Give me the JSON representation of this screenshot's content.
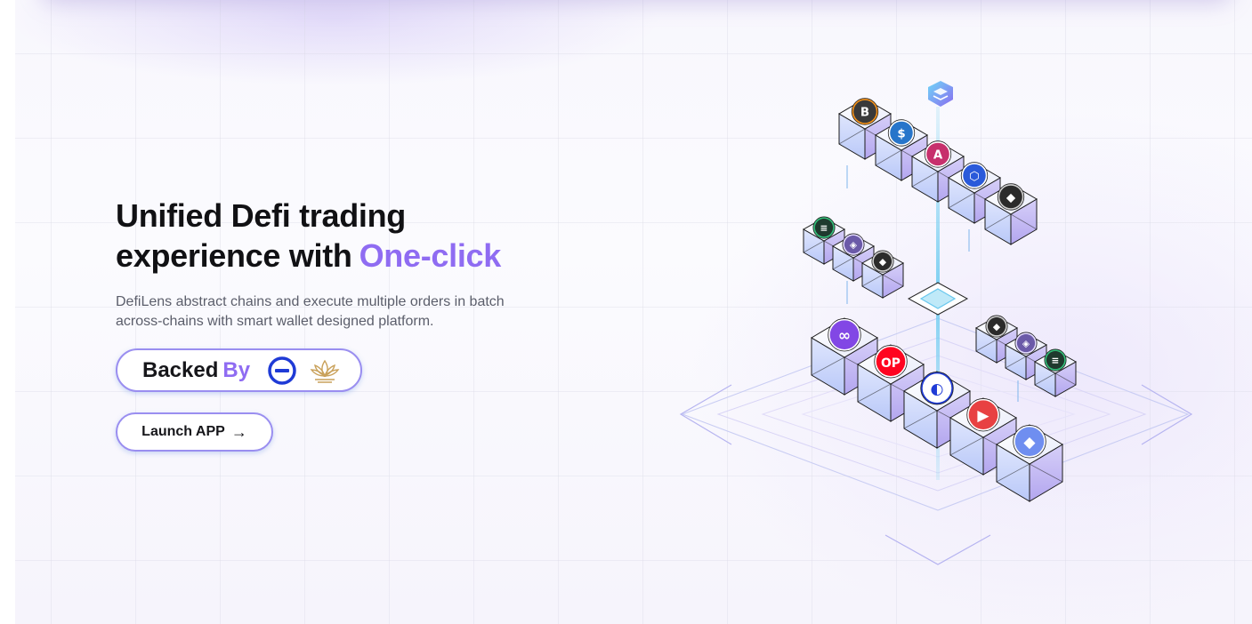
{
  "hero": {
    "title_line1": "Unified Defi trading",
    "title_line2": "experience with",
    "title_accent": "One-click",
    "description_line1": "DefiLens abstract chains and execute multiple orders in batch",
    "description_line2": "across-chains with smart wallet designed platform."
  },
  "backed": {
    "label": "Backed",
    "by": "By",
    "backers": [
      {
        "icon": "blue-circle-minus-logo-icon"
      },
      {
        "icon": "gold-lotus-logo-icon"
      }
    ]
  },
  "cta": {
    "label": "Launch APP",
    "arrow": "→"
  },
  "illustration": {
    "top_icon": "stack-layers-icon",
    "row_a_tokens": [
      "bitcoin-token-icon",
      "usdc-token-icon",
      "aave-token-icon",
      "chainlink-token-icon",
      "dark-token-icon"
    ],
    "row_b_tokens": [
      "green-token-icon",
      "purple-token-icon",
      "dark-token-icon"
    ],
    "row_c_tokens": [
      "polygon-token-icon",
      "optimism-token-icon",
      "blue-bridge-token-icon",
      "red-play-token-icon",
      "ethereum-token-icon"
    ],
    "row_d_tokens": [
      "dark-token-icon",
      "purple-token-icon",
      "green-token-icon"
    ],
    "op_label": "OP",
    "colors": {
      "accent": "#8f6cf2",
      "cube_face_light": "#eef0ff",
      "cube_face_blue": "#c8d4fb",
      "cube_face_purple": "#bfb2f2",
      "beam": "#7fd3f0"
    }
  }
}
